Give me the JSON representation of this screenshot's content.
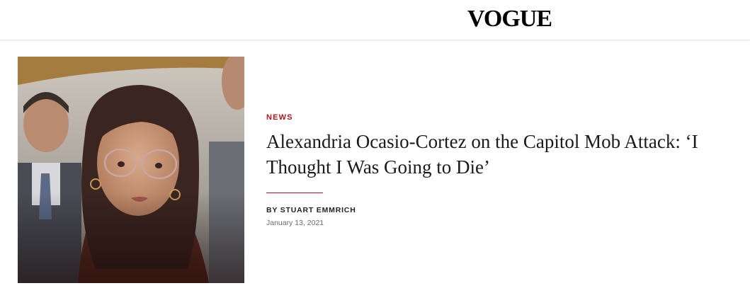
{
  "header": {
    "logo_text": "VOGUE"
  },
  "article": {
    "category": "NEWS",
    "headline": "Alexandria Ocasio-Cortez on the Capitol Mob Attack: ‘I Thought I Was Going to Die’",
    "byline": "BY STUART EMMRICH",
    "date": "January 13, 2021"
  },
  "colors": {
    "accent": "#b0151e",
    "text": "#1a1a1a",
    "muted": "#6b6b6b"
  }
}
